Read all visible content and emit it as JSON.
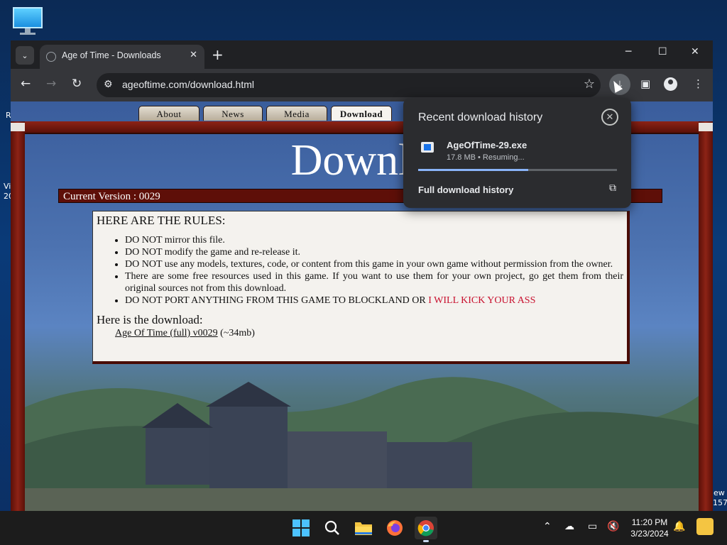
{
  "desktop": {
    "icon": "monitor-icon",
    "edge_texts_left": [
      "R",
      "Vi",
      "20"
    ],
    "edge_texts_right": [
      "ew",
      "157"
    ]
  },
  "browser": {
    "tab": {
      "title": "Age of Time - Downloads",
      "close_glyph": "✕"
    },
    "newtab_glyph": "+",
    "window_controls": {
      "minimize": "─",
      "maximize": "☐",
      "close": "✕"
    },
    "address": {
      "url": "ageoftime.com/download.html"
    },
    "toolbar_icons": [
      "back-icon",
      "forward-icon",
      "reload-icon",
      "site-settings-icon",
      "bookmark-star-icon",
      "downloads-icon",
      "side-panel-icon",
      "profile-icon",
      "menu-icon"
    ]
  },
  "page": {
    "nav_tabs": [
      "About",
      "News",
      "Media",
      "Download"
    ],
    "active_tab": "Download",
    "title": "Downlo",
    "version": "Current Version : 0029",
    "rules_heading": "HERE ARE THE RULES:",
    "rules": [
      "DO NOT mirror this file.",
      "DO NOT modify the game and re-release it.",
      "DO NOT use any models, textures, code, or content from this game in your own game without permission from the owner.",
      "There are some free resources used in this game. If you want to use them for your own project, go get them from their original sources not from this download."
    ],
    "last_rule_prefix": "DO NOT PORT ANYTHING FROM THIS GAME TO BLOCKLAND OR ",
    "last_rule_warning": "I WILL KICK YOUR ASS",
    "download_heading": "Here is the download:",
    "download_link": "Age Of Time (full) v0029",
    "download_size": " (~34mb)"
  },
  "downloads_popup": {
    "title": "Recent download history",
    "file_name": "AgeOfTime-29.exe",
    "status": "17.8 MB • Resuming...",
    "progress_fraction": 0.555,
    "history_link": "Full download history"
  },
  "taskbar": {
    "apps": [
      "windows-start-icon",
      "search-icon",
      "file-explorer-icon",
      "firefox-icon",
      "chrome-icon"
    ],
    "active_app": "chrome-icon",
    "time": "11:20 PM",
    "date": "3/23/2024"
  },
  "colors": {
    "chrome_dark": "#202124",
    "toolbar": "#35363a",
    "frame_red": "#8d2316",
    "warning_red": "#c8102e",
    "progress_blue": "#8ab4f8"
  }
}
